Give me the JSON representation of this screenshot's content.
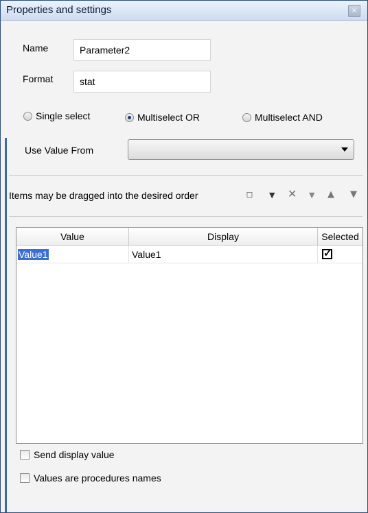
{
  "window": {
    "title": "Properties and settings",
    "close_glyph": "×"
  },
  "form": {
    "name_label": "Name",
    "name_value": "Parameter2",
    "format_label": "Format",
    "format_value": "stat",
    "radios": [
      {
        "label": "Single select",
        "checked": false
      },
      {
        "label": "Multiselect OR",
        "checked": true
      },
      {
        "label": "Multiselect AND",
        "checked": false
      }
    ],
    "use_value_from_label": "Use Value From",
    "use_value_from_value": ""
  },
  "toolbar": {
    "hint": "Items may be dragged into the desired order",
    "new_glyph": "▫",
    "dropdown_glyph": "▼",
    "delete_glyph": "✕",
    "up_glyph": "▲",
    "down_glyph": "▼"
  },
  "grid": {
    "columns": [
      "Value",
      "Display",
      "Selected"
    ],
    "rows": [
      {
        "value": "Value1",
        "display": "Value1",
        "selected": true
      }
    ]
  },
  "options": {
    "send_display_value": "Send display value",
    "values_are_procedures_names": "Values are procedures names"
  },
  "colors": {
    "accent": "#3a6ed1",
    "border": "#2b4d7a"
  }
}
